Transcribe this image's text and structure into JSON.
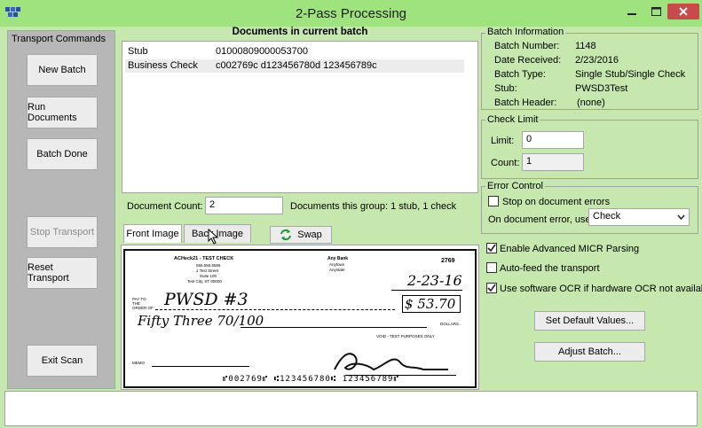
{
  "window": {
    "title": "2-Pass Processing",
    "accent": "#9ee37d",
    "close_color": "#c94a4a"
  },
  "transport": {
    "legend": "Transport Commands",
    "new_batch": "New Batch",
    "run_documents": "Run Documents",
    "batch_done": "Batch Done",
    "stop_transport": "Stop Transport",
    "reset_transport": "Reset Transport",
    "exit_scan": "Exit Scan"
  },
  "documents": {
    "header": "Documents in current batch",
    "rows": [
      {
        "type": "Stub",
        "data": "01000809000053700"
      },
      {
        "type": "Business Check",
        "data": "c002769c d123456780d 123456789c"
      }
    ],
    "count_label": "Document Count:",
    "count_value": "2",
    "group_text": "Documents this group: 1 stub, 1 check"
  },
  "image_tabs": {
    "front": "Front Image",
    "back": "Back Image",
    "swap": "Swap"
  },
  "check_image": {
    "company": "ACHeck21 - TEST CHECK",
    "company_line2": "555.555.5555",
    "company_line3": "1 Test Street",
    "company_line4": "Suite 100",
    "company_line5": "Test City, ST 00000",
    "bank": "Any Bank",
    "bank_line2": "Anytown",
    "bank_line3": "Anystate",
    "check_number": "2769",
    "date": "2-23-16",
    "pay_to_label": "PAY TO THE ORDER OF",
    "payee": "PWSD #3",
    "amount": "$ 53.70",
    "written": "Fifty Three 70/100",
    "dollars": "DOLLARS",
    "void": "VOID - TEST PURPOSES ONLY",
    "memo": "MEMO",
    "micr": "⑈002769⑈ ⑆123456780⑆ 123456789⑈"
  },
  "batch_info": {
    "legend": "Batch Information",
    "rows": [
      {
        "label": "Batch Number:",
        "value": "1148"
      },
      {
        "label": "Date Received:",
        "value": "2/23/2016"
      },
      {
        "label": "Batch Type:",
        "value": "Single Stub/Single Check"
      },
      {
        "label": "Stub:",
        "value": "PWSD3Test"
      },
      {
        "label": "Batch Header:",
        "value": "(none)"
      }
    ]
  },
  "check_limit": {
    "legend": "Check Limit",
    "limit_label": "Limit:",
    "limit_value": "0",
    "count_label": "Count:",
    "count_value": "1"
  },
  "error_control": {
    "legend": "Error Control",
    "stop_label": "Stop on document errors",
    "stop_checked": false,
    "on_error_label": "On document error, use:",
    "on_error_value": "Check"
  },
  "options": {
    "micr_label": "Enable Advanced MICR Parsing",
    "micr_checked": true,
    "autofeed_label": "Auto-feed the transport",
    "autofeed_checked": false,
    "ocr_label": "Use software OCR if hardware OCR not available",
    "ocr_checked": true
  },
  "actions": {
    "set_defaults": "Set Default Values...",
    "adjust_batch": "Adjust Batch..."
  },
  "status": {
    "text": ""
  }
}
